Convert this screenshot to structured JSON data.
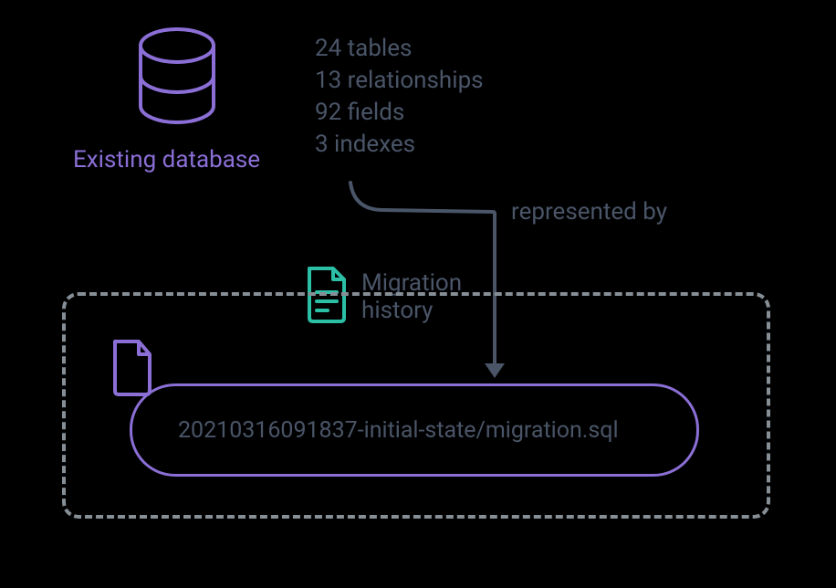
{
  "database": {
    "label": "Existing database",
    "stats": {
      "tables": "24 tables",
      "relationships": "13 relationships",
      "fields": "92 fields",
      "indexes": "3 indexes"
    }
  },
  "connector": {
    "label": "represented by"
  },
  "migration": {
    "heading_line1": "Migration",
    "heading_line2": "history",
    "filename": "20210316091837-initial-state/migration.sql"
  },
  "colors": {
    "purple": "#8b6fd6",
    "gray": "#4a5568",
    "dash": "#868e96",
    "teal": "#2bbfa5"
  }
}
